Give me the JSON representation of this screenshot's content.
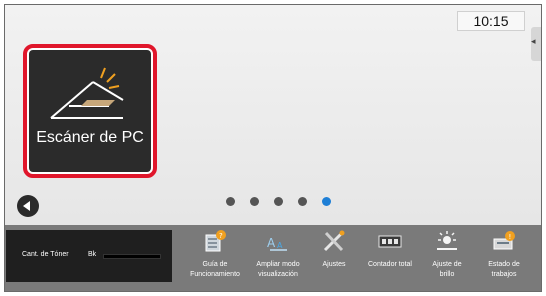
{
  "status": {
    "clock": "10:15"
  },
  "side_handle": {
    "icon": "collapse-arrow-icon",
    "glyph": "◂"
  },
  "tile": {
    "label": "Escáner de PC",
    "icon": "pc-scanner-icon",
    "highlight_color": "#e0162b"
  },
  "pagination": {
    "pages": 5,
    "active_index": 4,
    "active_color": "#1e7fd6",
    "inactive_color": "#555555"
  },
  "toner": {
    "label": "Cant. de Tóner",
    "bk_label": "Bk"
  },
  "nav": [
    {
      "name": "guide",
      "label_line1": "Guía de",
      "label_line2": "Funcionamiento",
      "icon": "operation-guide-icon"
    },
    {
      "name": "zoom",
      "label_line1": "Ampliar modo",
      "label_line2": "visualización",
      "icon": "zoom-display-icon"
    },
    {
      "name": "settings",
      "label_line1": "Ajustes",
      "label_line2": "",
      "icon": "settings-tools-icon"
    },
    {
      "name": "counter",
      "label_line1": "Contador total",
      "label_line2": "",
      "icon": "total-counter-icon"
    },
    {
      "name": "brightness",
      "label_line1": "Ajuste de",
      "label_line2": "brillo",
      "icon": "brightness-icon"
    },
    {
      "name": "jobs",
      "label_line1": "Estado de",
      "label_line2": "trabajos",
      "icon": "job-status-icon"
    }
  ]
}
